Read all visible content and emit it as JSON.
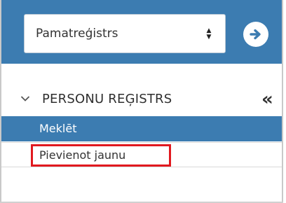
{
  "registry_select": {
    "selected": "Pamatreģistrs"
  },
  "icons": {
    "go": "arrow-right-circle-icon",
    "caret": "sort-caret-icon",
    "section_chevron": "chevron-down-icon",
    "collapse": "double-chevron-left-icon"
  },
  "sidebar": {
    "section_title": "PERSONU REĢISTRS",
    "collapse_glyph": "«",
    "items": [
      {
        "label": "Meklēt",
        "active": true
      },
      {
        "label": "Pievienot jaunu",
        "active": false
      }
    ]
  },
  "colors": {
    "accent": "#3c7cb1",
    "highlight": "#e1191f"
  }
}
